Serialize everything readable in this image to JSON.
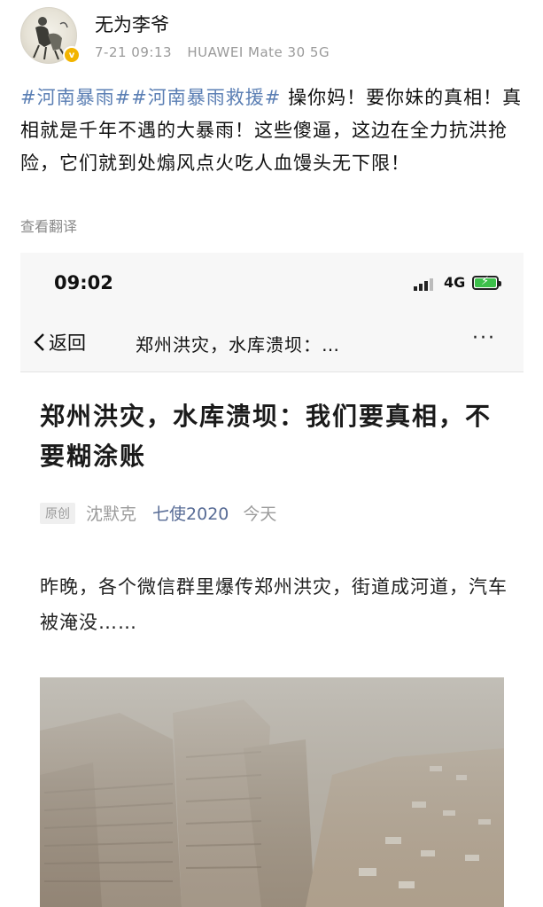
{
  "author": {
    "username": "无为李爷",
    "badge": "v",
    "date": "7-21 09:13",
    "device": "HUAWEI Mate 30 5G"
  },
  "post": {
    "hashtag1": "#河南暴雨#",
    "hashtag2": "#河南暴雨救援#",
    "text": " 操你妈！要你妹的真相！真相就是千年不遇的大暴雨！这些傻逼，这边在全力抗洪抢险，它们就到处煽风点火吃人血馒头无下限！",
    "translate_label": "查看翻译"
  },
  "screenshot": {
    "status": {
      "time": "09:02",
      "network": "4G"
    },
    "nav": {
      "back_label": "返回",
      "title": "郑州洪灾，水库溃坝：…",
      "more": "···"
    },
    "article": {
      "title": "郑州洪灾，水库溃坝：我们要真相，不要糊涂账",
      "original_tag": "原创",
      "author": "沈默克",
      "account": "七使2020",
      "date": "今天",
      "body": "昨晚，各个微信群里爆传郑州洪灾，街道成河道，汽车被淹没……"
    }
  },
  "colors": {
    "hashtag": "#5b7fb4",
    "account_link": "#576b95",
    "badge": "#f2b400",
    "battery": "#3cc04a"
  }
}
